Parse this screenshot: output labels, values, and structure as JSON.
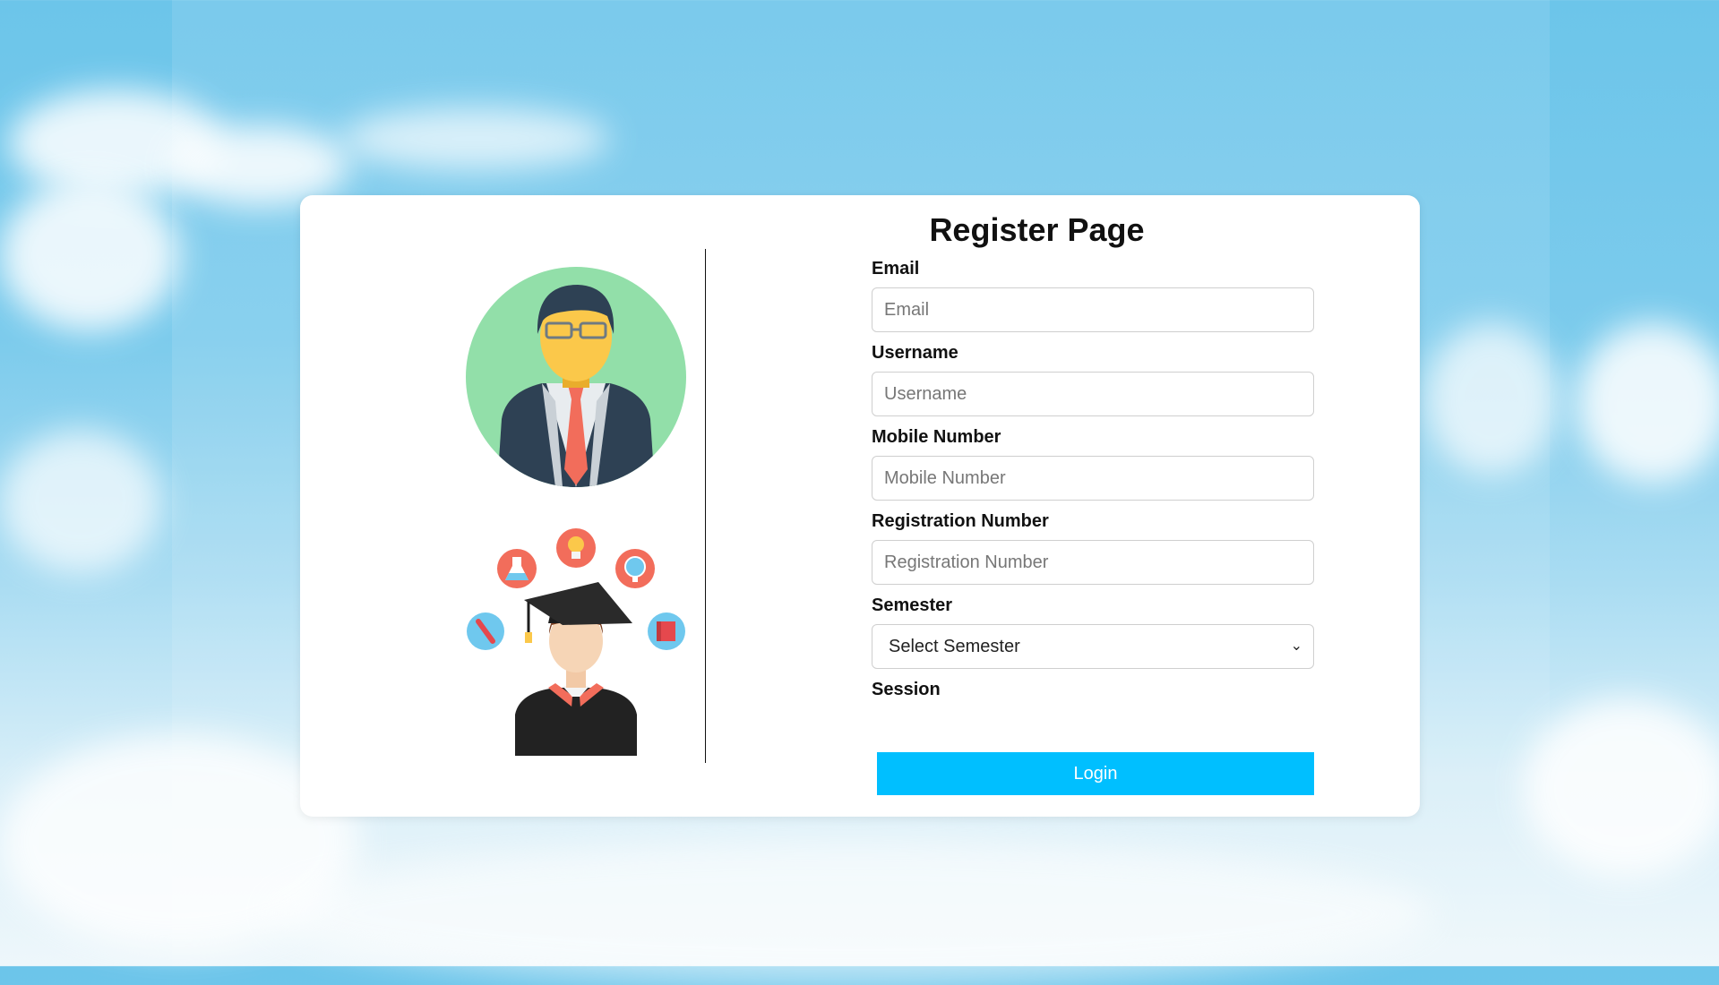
{
  "page": {
    "title": "Register Page"
  },
  "form": {
    "email": {
      "label": "Email",
      "placeholder": "Email"
    },
    "username": {
      "label": "Username",
      "placeholder": "Username"
    },
    "mobile": {
      "label": "Mobile Number",
      "placeholder": "Mobile Number"
    },
    "registration": {
      "label": "Registration Number",
      "placeholder": "Registration Number"
    },
    "semester": {
      "label": "Semester",
      "selected": "Select Semester"
    },
    "session": {
      "label": "Session"
    },
    "submit_label": "Login"
  },
  "colors": {
    "accent": "#00bfff",
    "avatar_bg": "#92dfa9",
    "sky": "#6cc5ea"
  },
  "icons": [
    "teacher-avatar-icon",
    "graduate-student-icon",
    "lightbulb-icon",
    "flask-icon",
    "globe-icon",
    "pencil-icon",
    "book-icon",
    "chevron-down-icon"
  ]
}
